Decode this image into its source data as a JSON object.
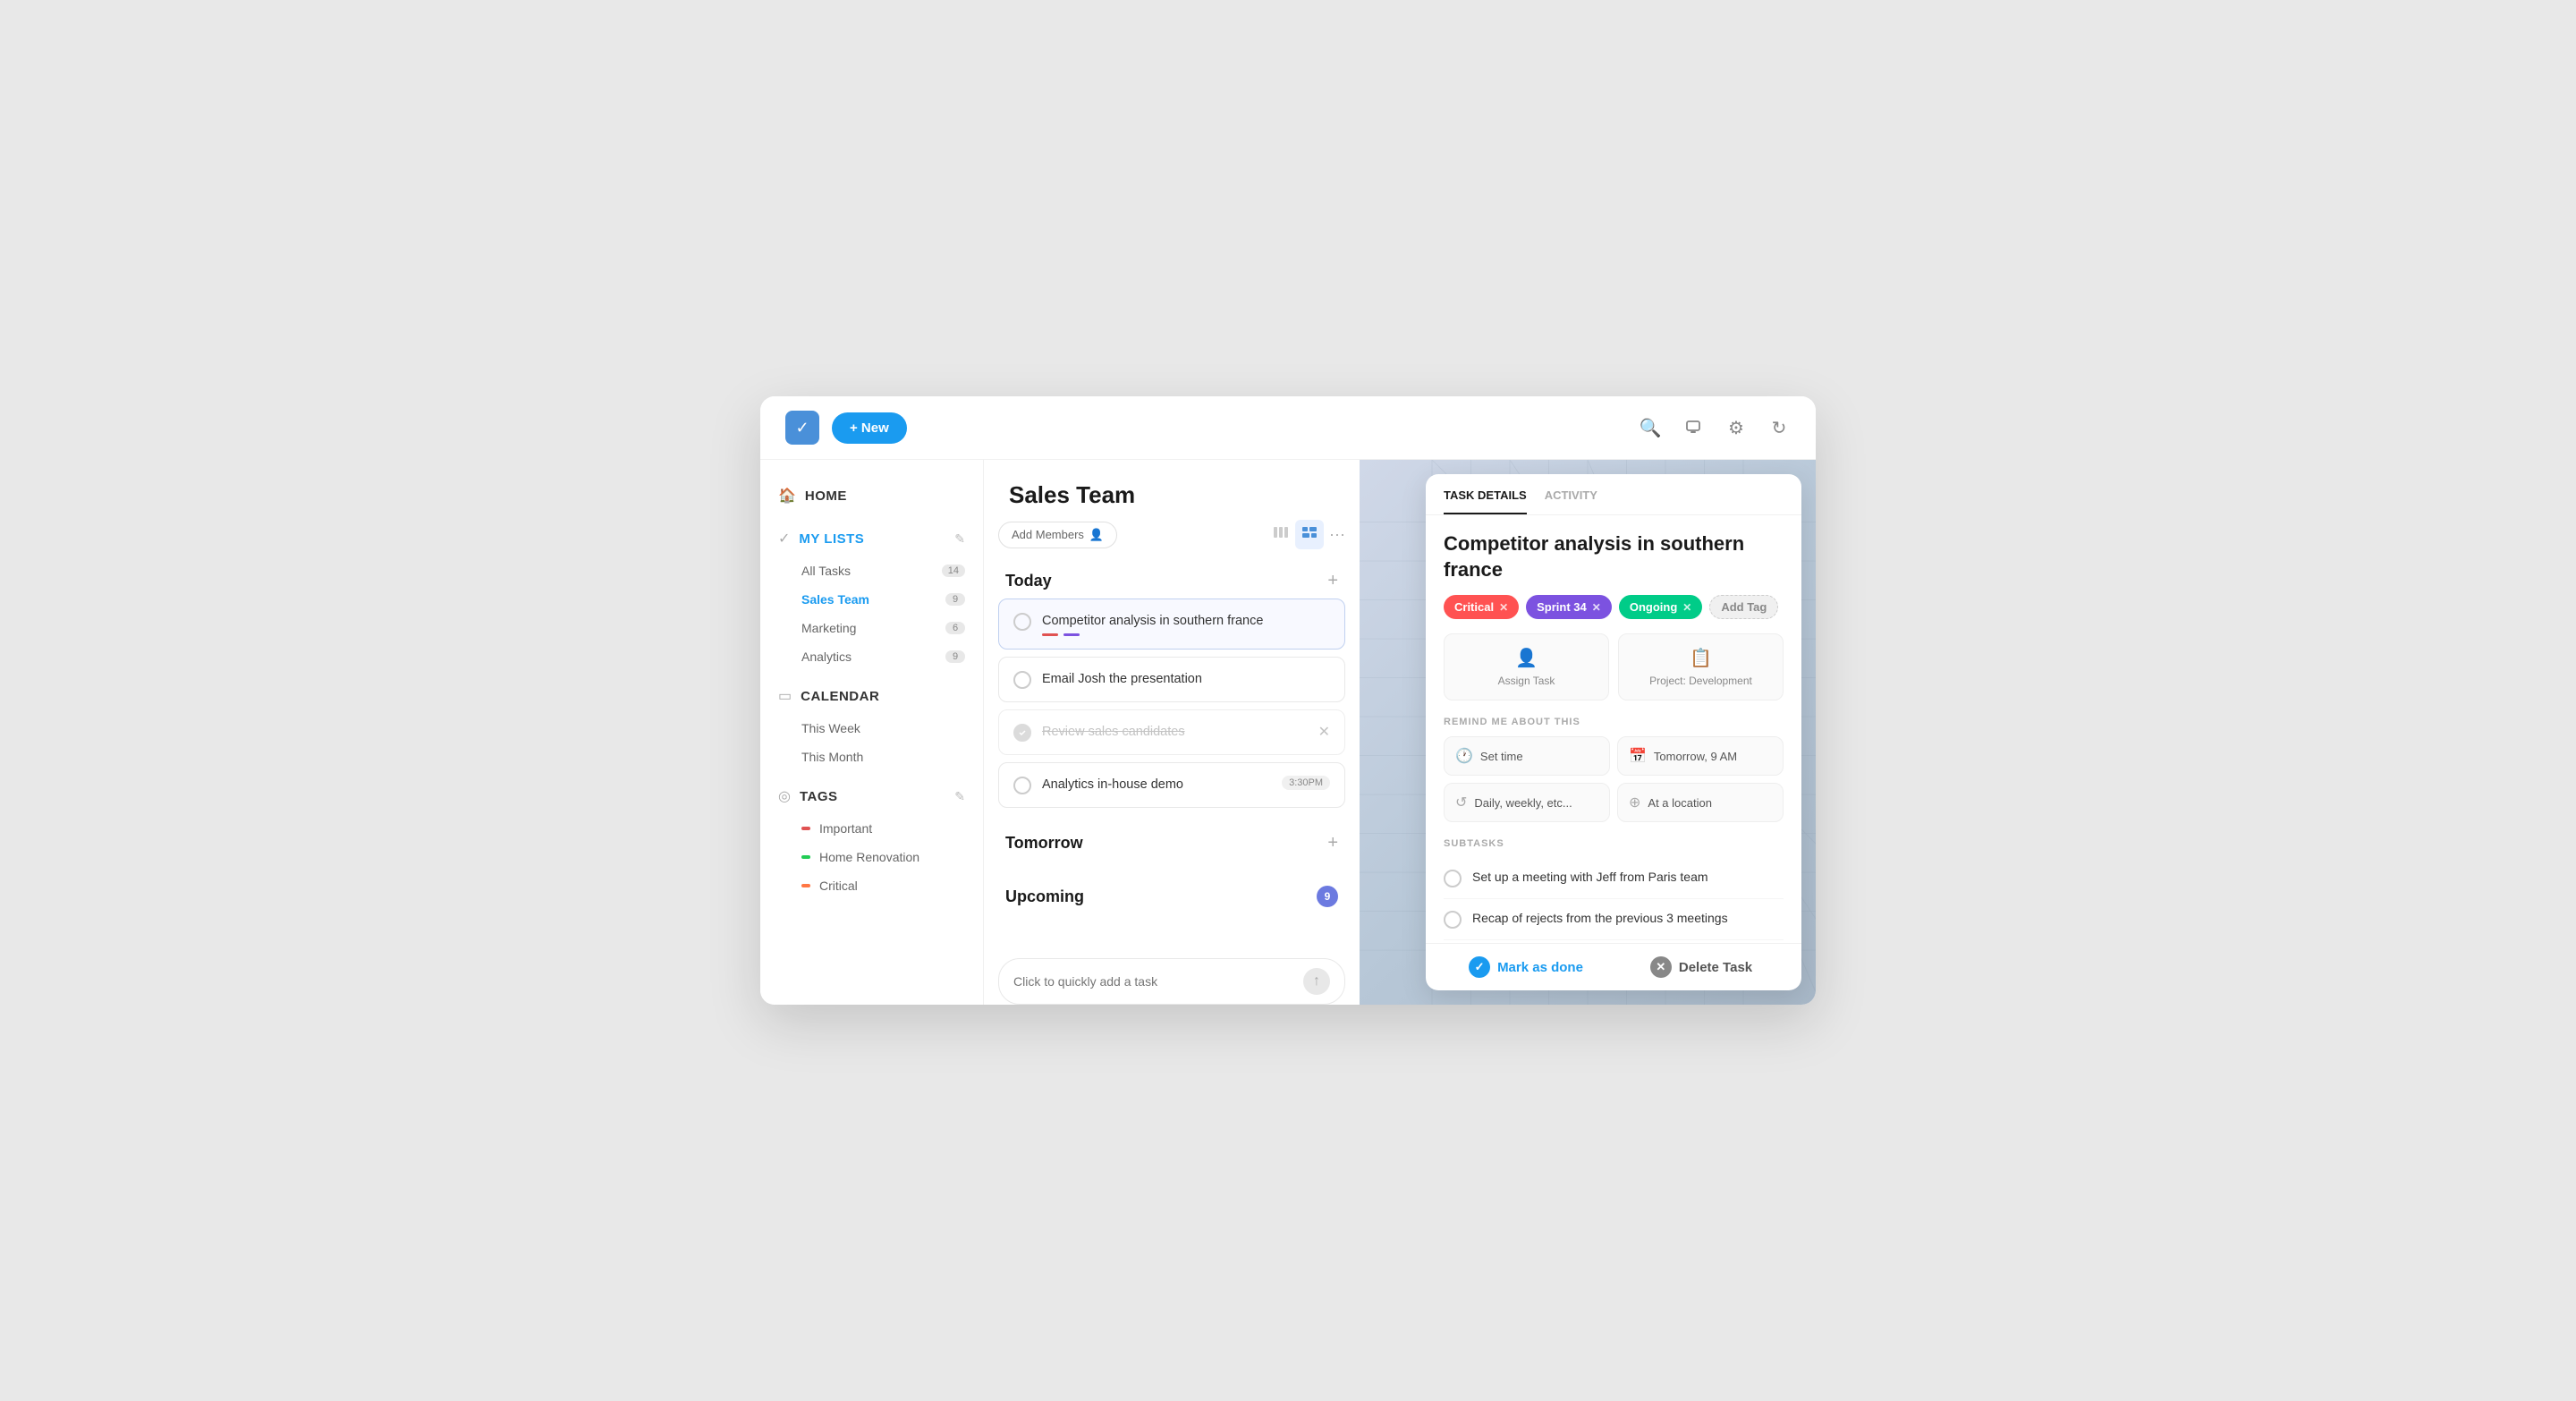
{
  "topbar": {
    "new_label": "+ New",
    "search_icon": "🔍",
    "notifications_icon": "🔔",
    "settings_icon": "⚙",
    "refresh_icon": "↻"
  },
  "sidebar": {
    "home_label": "HOME",
    "my_lists_label": "MY LISTS",
    "all_tasks_label": "All Tasks",
    "all_tasks_count": "14",
    "sales_team_label": "Sales Team",
    "sales_team_count": "9",
    "marketing_label": "Marketing",
    "marketing_count": "6",
    "analytics_label": "Analytics",
    "analytics_count": "9",
    "calendar_label": "CALENDAR",
    "this_week_label": "This Week",
    "this_month_label": "This Month",
    "tags_label": "TAGS",
    "tag_important_label": "Important",
    "tag_home_label": "Home Renovation",
    "tag_critical_label": "Critical"
  },
  "tasks": {
    "title": "Sales Team",
    "add_members_label": "Add Members",
    "today_label": "Today",
    "tomorrow_label": "Tomorrow",
    "upcoming_label": "Upcoming",
    "upcoming_count": "9",
    "task1_text": "Competitor analysis in southern france",
    "task2_text": "Email Josh the presentation",
    "task3_text": "Review sales candidates",
    "task4_text": "Analytics in-house demo",
    "task4_time": "3:30PM",
    "quick_add_placeholder": "Click to quickly add a task"
  },
  "detail": {
    "tab_details": "TASK DETAILS",
    "tab_activity": "ACTIVITY",
    "title": "Competitor analysis in southern france",
    "tag_critical": "Critical",
    "tag_sprint": "Sprint 34",
    "tag_ongoing": "Ongoing",
    "tag_add": "Add Tag",
    "assign_label": "Assign Task",
    "project_label": "Project: Development",
    "remind_section": "REMIND ME ABOUT THIS",
    "remind_set_time": "Set time",
    "remind_tomorrow": "Tomorrow, 9 AM",
    "remind_daily": "Daily, weekly, etc...",
    "remind_location": "At a location",
    "subtasks_section": "SUBTASKS",
    "subtask1": "Set up a meeting with Jeff from Paris team",
    "subtask2": "Recap of rejects from the previous 3 meetings",
    "mark_done_label": "Mark as done",
    "delete_label": "Delete Task"
  }
}
